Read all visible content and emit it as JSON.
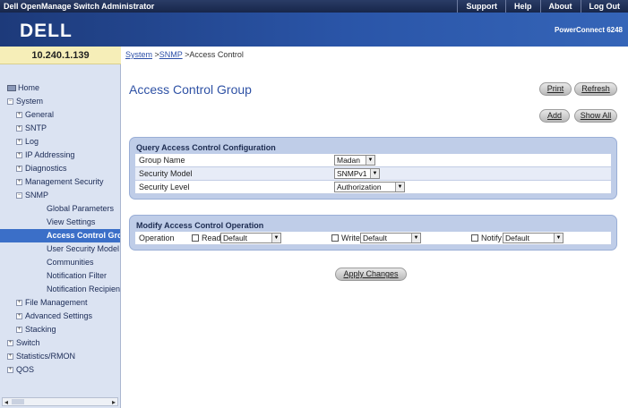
{
  "app_title": "Dell OpenManage Switch Administrator",
  "top_links": [
    "Support",
    "Help",
    "About",
    "Log Out"
  ],
  "logo": "DELL",
  "product": "PowerConnect 6248",
  "ip": "10.240.1.139",
  "tree": [
    {
      "label": "Home",
      "icon": "home-icon",
      "level": 0,
      "sel": false
    },
    {
      "label": "System",
      "icon": "collapse-icon",
      "level": 0,
      "sel": false
    },
    {
      "label": "General",
      "icon": "expand-icon",
      "level": 1,
      "sel": false
    },
    {
      "label": "SNTP",
      "icon": "expand-icon",
      "level": 1,
      "sel": false
    },
    {
      "label": "Log",
      "icon": "expand-icon",
      "level": 1,
      "sel": false
    },
    {
      "label": "IP Addressing",
      "icon": "expand-icon",
      "level": 1,
      "sel": false
    },
    {
      "label": "Diagnostics",
      "icon": "expand-icon",
      "level": 1,
      "sel": false
    },
    {
      "label": "Management Security",
      "icon": "expand-icon",
      "level": 1,
      "sel": false
    },
    {
      "label": "SNMP",
      "icon": "collapse-icon",
      "level": 1,
      "sel": false
    },
    {
      "label": "Global Parameters",
      "icon": "",
      "level": 2,
      "sel": false
    },
    {
      "label": "View Settings",
      "icon": "",
      "level": 2,
      "sel": false
    },
    {
      "label": "Access Control Grou",
      "icon": "",
      "level": 2,
      "sel": true
    },
    {
      "label": "User Security Model",
      "icon": "",
      "level": 2,
      "sel": false
    },
    {
      "label": "Communities",
      "icon": "",
      "level": 2,
      "sel": false
    },
    {
      "label": "Notification Filter",
      "icon": "",
      "level": 2,
      "sel": false
    },
    {
      "label": "Notification Recipient",
      "icon": "",
      "level": 2,
      "sel": false
    },
    {
      "label": "File Management",
      "icon": "expand-icon",
      "level": 1,
      "sel": false
    },
    {
      "label": "Advanced Settings",
      "icon": "expand-icon",
      "level": 1,
      "sel": false
    },
    {
      "label": "Stacking",
      "icon": "expand-icon",
      "level": 1,
      "sel": false
    },
    {
      "label": "Switch",
      "icon": "expand-icon",
      "level": 0,
      "sel": false
    },
    {
      "label": "Statistics/RMON",
      "icon": "expand-icon",
      "level": 0,
      "sel": false
    },
    {
      "label": "QOS",
      "icon": "expand-icon",
      "level": 0,
      "sel": false
    }
  ],
  "breadcrumb": {
    "system": "System",
    "sep1": " >",
    "snmp": "SNMP",
    "current": " >Access Control"
  },
  "page_title": "Access Control Group",
  "buttons": {
    "print": "Print",
    "refresh": "Refresh",
    "add": "Add",
    "show_all": "Show All",
    "apply": "Apply Changes"
  },
  "query": {
    "heading": "Query Access Control Configuration",
    "group_name_label": "Group Name",
    "group_name_value": "Madan",
    "security_model_label": "Security Model",
    "security_model_value": "SNMPv1",
    "security_level_label": "Security Level",
    "security_level_value": "Authorization"
  },
  "modify": {
    "heading": "Modify Access Control Operation",
    "operation_label": "Operation",
    "read_label": "Read",
    "read_value": "Default",
    "write_label": "Write",
    "write_value": "Default",
    "notify_label": "Notify",
    "notify_value": "Default"
  }
}
